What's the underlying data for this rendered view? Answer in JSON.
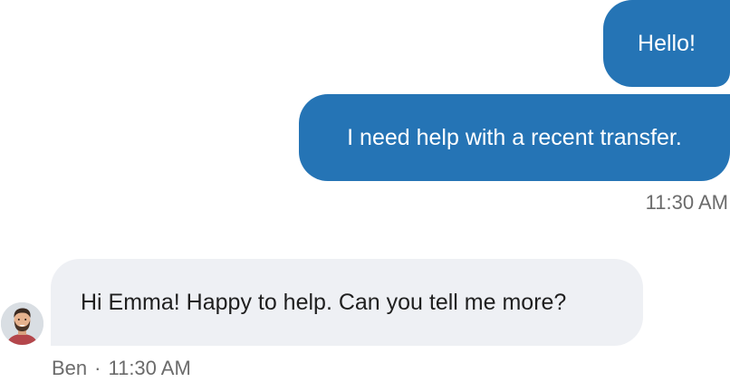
{
  "messages": {
    "outgoing": [
      {
        "text": "Hello!"
      },
      {
        "text": "I need help with a recent transfer."
      }
    ],
    "outgoing_timestamp": "11:30 AM",
    "incoming": {
      "text": "Hi Emma! Happy to help. Can you tell me more?",
      "sender": "Ben",
      "separator": "·",
      "timestamp": "11:30 AM"
    }
  },
  "colors": {
    "outgoing_bubble": "#2574b5",
    "incoming_bubble": "#eef0f4",
    "meta_text": "#6b6b6b"
  },
  "icons": {
    "avatar": "agent-avatar-photo"
  }
}
